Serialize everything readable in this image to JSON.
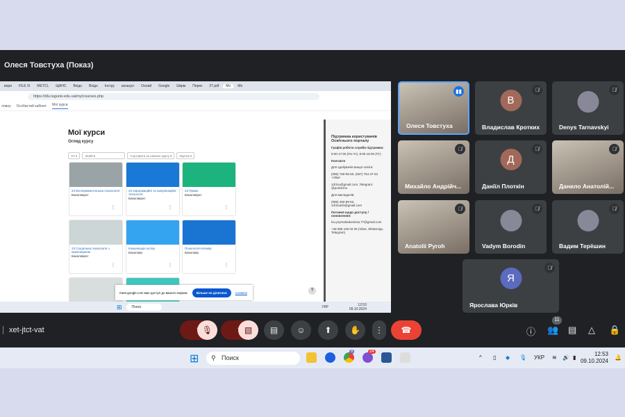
{
  "meet": {
    "presenter_title": "Олеся Товстуха (Показ)",
    "meeting_code": "xet-jtct-vat",
    "participant_count": "11"
  },
  "shared_screen": {
    "browser_tabs": [
      "вори",
      "FILE Vi",
      "METCL",
      "ЩАНС",
      "Вхідн",
      "Вхідн",
      "Інстру",
      "калькул",
      "Онлай",
      "Google",
      "Шкрм",
      "Перек",
      "27.pdf",
      "Мо",
      "Ме"
    ],
    "url": "https://dlu.luguniv.edu.ua/my/courses.php",
    "nav": [
      "ловну",
      "Особистий кабінет",
      "Мої курси"
    ],
    "page_title": "Мої курси",
    "page_subtitle": "Огляд курсу",
    "filters": [
      "Усі ▾",
      "Знайти",
      "Сортувати за назвою курсу ▾",
      "Картка ▾"
    ],
    "courses": [
      {
        "name": "23 Експериментальна психологія",
        "category": "Бакалаврат",
        "color": "#9aa3a6"
      },
      {
        "name": "23 Інформаційні та комунікаційні технології",
        "category": "Бакалаврат",
        "color": "#1a78d6"
      },
      {
        "name": "23 Право",
        "category": "Бакалаврат",
        "color": "#1db37f"
      },
      {
        "name": "23 Соціальна психологія з практикумом",
        "category": "Бакалаврат",
        "color": "#cdd6d6"
      },
      {
        "name": "Комунікація успіху",
        "category": "Бакалавр",
        "color": "#34a4f0"
      },
      {
        "name": "Психологія впливу",
        "category": "Бакалавр",
        "color": "#1a74d2"
      }
    ],
    "support": {
      "title": "Підтримка користувачів Освітнього порталу",
      "schedule_label": "Графік роботи служби підтримки:",
      "schedule": "8:00-17:00 (Пн-Чт), 8:00-16:00 (Пт)",
      "contacts_label": "Контакти",
      "applicants_label": "Для здобувачів вищої освіти:",
      "phones": "(095) 769-05-50, (067) 754-47-53 +Viber",
      "email1": "zdl.lnu@gmail.com, Telegram: @portal.lnu",
      "teachers_label": "Для викладачів:",
      "teachers": "(095) 450-89-62, zdl.lnutsh@gmail.com",
      "access_label": "Питання щодо доступу / поновлення:",
      "access_email": "lnu.prymalnakomisia.77@gmail.com",
      "access_phone": "+38 095 105 02 05 (Viber, WhatsApp, Telegram)"
    },
    "share_toast": {
      "text": "meet.google.com має доступ до вашого екрана.",
      "stop": "Більше не ділитися",
      "hide": "Сховати"
    },
    "taskbar": {
      "search": "Поиск",
      "lang": "УКР",
      "time": "12:53",
      "date": "09.10.2024"
    }
  },
  "participants": [
    {
      "name": "Олеся Товстуха",
      "speaking": true,
      "video": true
    },
    {
      "name": "Владислав Кротких",
      "initial": "В",
      "color": "#a1695a"
    },
    {
      "name": "Denys Tarnavskyi",
      "photo": true
    },
    {
      "name": "Михайло Андрійч...",
      "video": true
    },
    {
      "name": "Даніїл Плоткін",
      "initial": "Д",
      "color": "#a1695a"
    },
    {
      "name": "Данило Анатолій...",
      "video": true
    },
    {
      "name": "Anatolii Pyroh",
      "video": true
    },
    {
      "name": "Vadym Borodin",
      "photo": true
    },
    {
      "name": "Вадим Терёшин",
      "photo": true
    },
    {
      "name": "Ярослава Юрків",
      "initial": "Я",
      "color": "#5c6bc0"
    }
  ],
  "taskbar": {
    "search": "Поиск",
    "lang": "УКР",
    "time": "12:53",
    "date": "09.10.2024",
    "viber_badge": "24",
    "chrome_badge": "8"
  },
  "colors": {
    "meet_bg": "#202124",
    "tile": "#3c4043",
    "end_call": "#ea4335",
    "mic_off": "#f9dedc"
  }
}
